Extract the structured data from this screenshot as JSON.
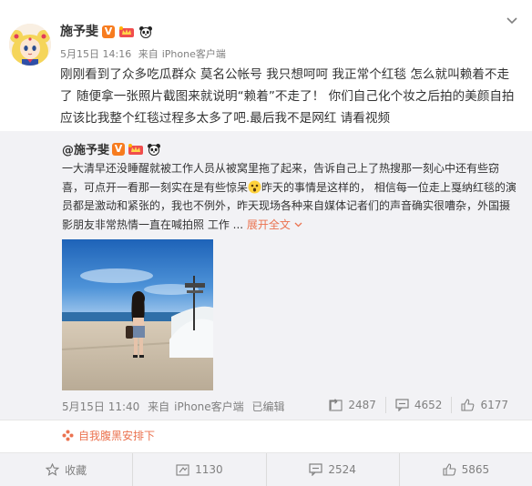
{
  "post": {
    "username": "施予斐",
    "verified_badge": "V",
    "timestamp": "5月15日 14:16",
    "source_prefix": "来自",
    "source": "iPhone客户端",
    "text": "刚刚看到了众多吃瓜群众 莫名公帐号 我只想呵呵 我正常个红毯 怎么就叫赖着不走了 随便拿一张照片截图来就说明“赖着”不走了！ 你们自己化个妆之后拍的美颜自拍应该比我整个红毯过程多太多了吧.最后我不是网红 请看视频"
  },
  "repost": {
    "username": "@施予斐",
    "verified_badge": "V",
    "text": "一大清早还没睡醒就被工作人员从被窝里拖了起来，告诉自己上了热搜那一刻心中还有些窃喜，可点开一看那一刻实在是有些惊呆",
    "text_after_emoji": "昨天的事情是这样的， 相信每一位走上戛纳红毯的演员都是激动和紧张的，我也不例外，昨天现场各种来自媒体记者们的声音确实很嘈杂，外国摄影朋友非常热情一直在喊拍照 工作 ...",
    "expand_label": "展开全文",
    "timestamp": "5月15日 11:40",
    "source_prefix": "来自",
    "source": "iPhone客户端",
    "edited_label": "已编辑",
    "reposts": "2487",
    "comments": "4652",
    "likes": "6177"
  },
  "related": {
    "label": "自我腹黑安排下"
  },
  "actions": {
    "favorite_label": "收藏",
    "repost_count": "1130",
    "comment_count": "2524",
    "like_count": "5865"
  },
  "colors": {
    "accent": "#eb7350",
    "muted": "#808080",
    "badge_orange": "#f77c1f",
    "repost_bg": "#f2f2f5"
  },
  "icons": {
    "avatar": "anime-avatar",
    "crown_badge": "crown-badge-icon",
    "panda_badge": "panda-icon",
    "menu": "chevron-down-icon",
    "repost": "repost-icon",
    "comment": "comment-icon",
    "like": "thumbs-up-icon",
    "favorite": "star-icon",
    "related": "flower-icon"
  }
}
